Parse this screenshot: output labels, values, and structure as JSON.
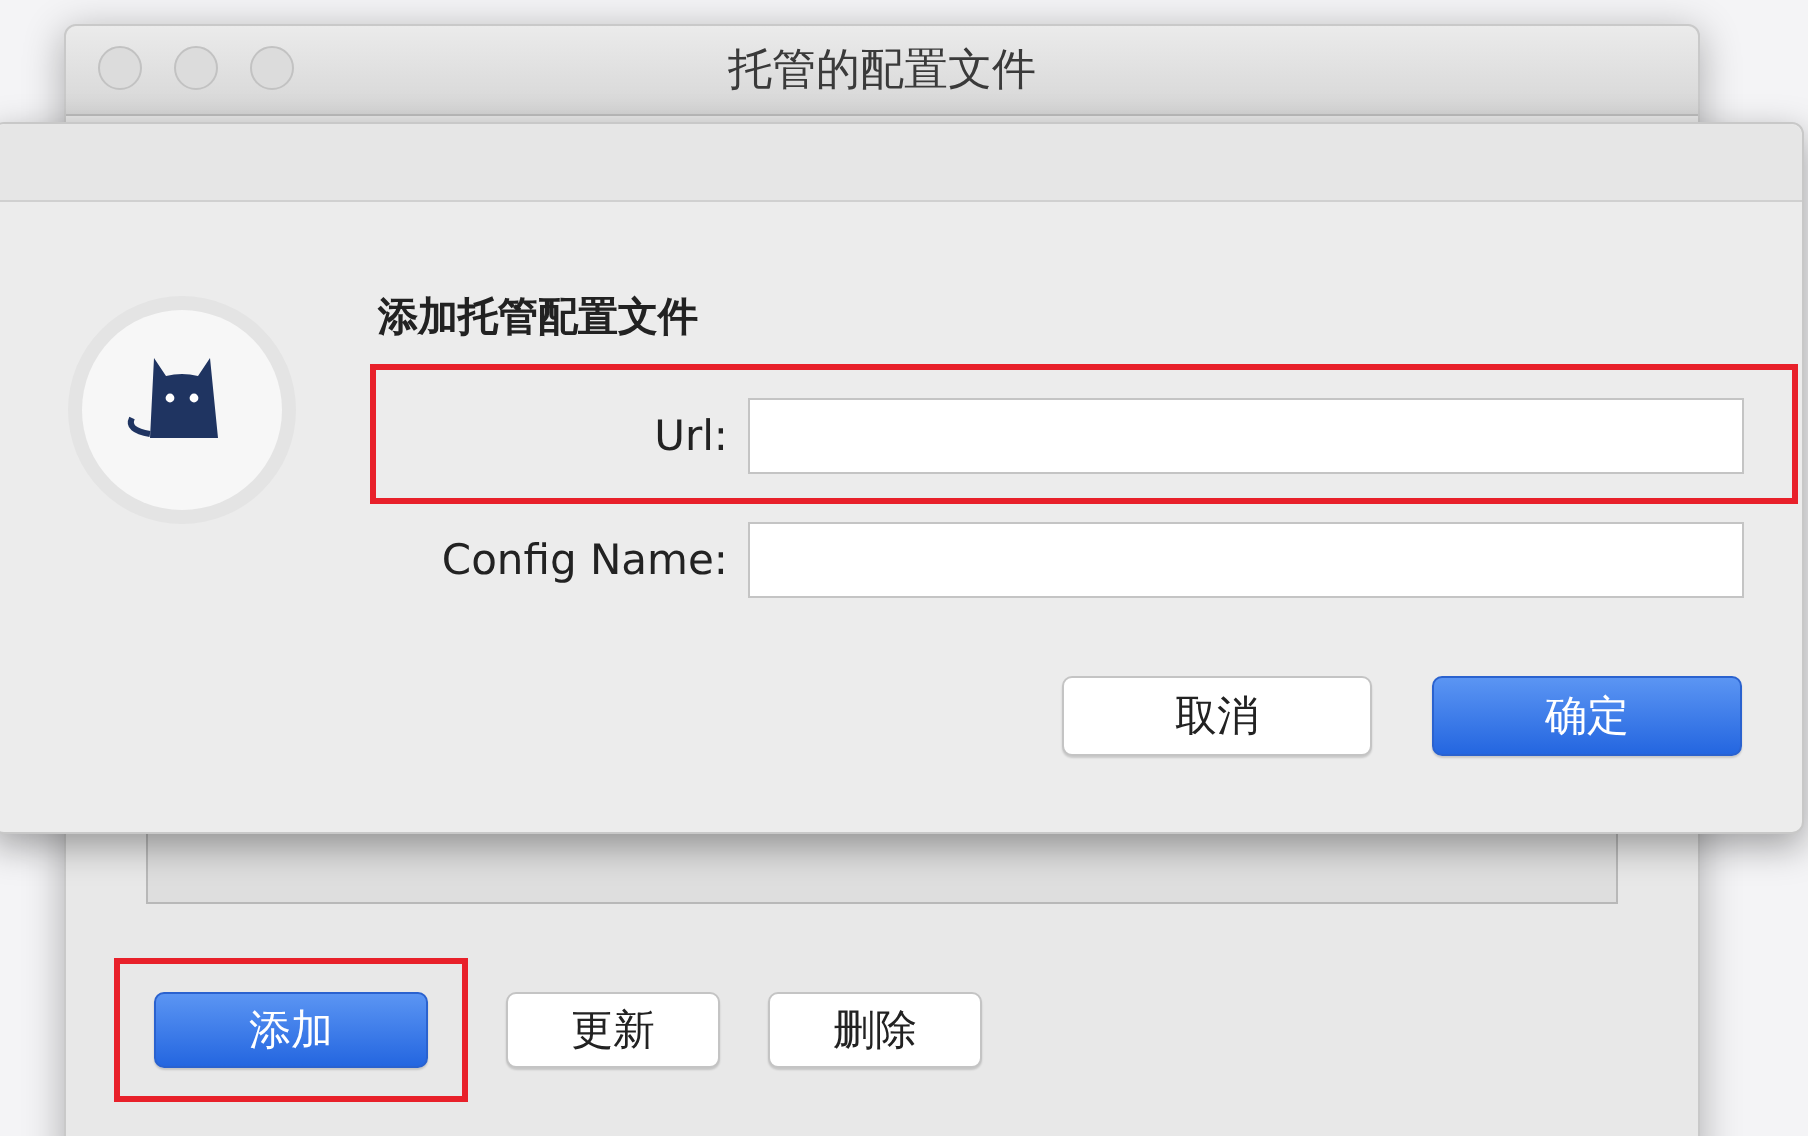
{
  "window": {
    "title": "托管的配置文件",
    "buttons": [
      {
        "label": "添加",
        "primary": true,
        "highlighted": true
      },
      {
        "label": "更新",
        "primary": false,
        "highlighted": false
      },
      {
        "label": "删除",
        "primary": false,
        "highlighted": false
      }
    ]
  },
  "dialog": {
    "title": "添加托管配置文件",
    "fields": [
      {
        "label": "Url:",
        "highlighted": true
      },
      {
        "label": "Config Name:",
        "highlighted": false
      }
    ],
    "buttons": [
      {
        "label": "取消",
        "primary": false
      },
      {
        "label": "确定",
        "primary": true
      }
    ]
  }
}
